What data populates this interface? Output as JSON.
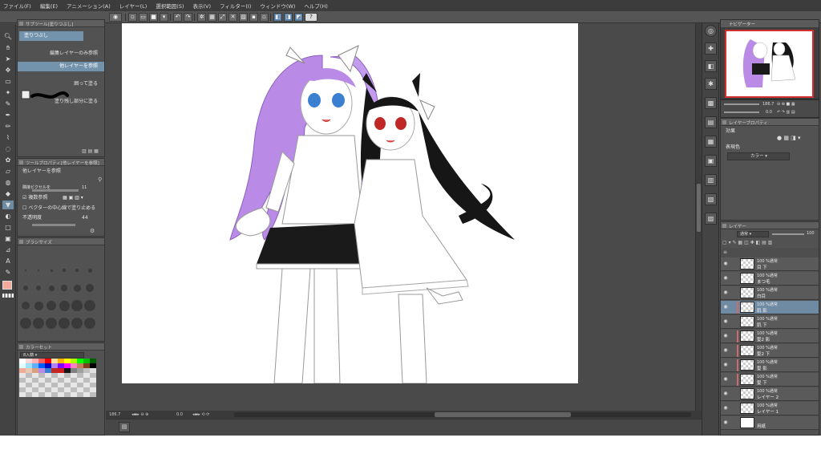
{
  "menu": [
    "ファイル(F)",
    "編集(E)",
    "アニメーション(A)",
    "レイヤー(L)",
    "選択範囲(S)",
    "表示(V)",
    "フィルター(I)",
    "ウィンドウ(W)",
    "ヘルプ(H)"
  ],
  "command_bar": {
    "help_label": "?"
  },
  "subtool": {
    "title": "サブツール[塗りつぶし]",
    "items": [
      {
        "label": "塗りつぶし"
      },
      {
        "label": "編集レイヤーのみ参照"
      },
      {
        "label": "他レイヤーを参照"
      },
      {
        "label": "囲って塗る"
      },
      {
        "label": "塗り残し部分に塗る"
      }
    ]
  },
  "tool_property": {
    "title": "ツールプロパティ[他レイヤーを参照]",
    "header": "他レイヤーを参照",
    "rows": [
      {
        "label": "隣接ピクセルを",
        "value": "11"
      },
      {
        "label": "複数参照"
      },
      {
        "label": "ベクターの中心線で塗り止める"
      },
      {
        "label": "不透明度",
        "value": "44"
      }
    ]
  },
  "brush_size": {
    "title": "ブラシサイズ"
  },
  "color_set": {
    "title": "カラーセット",
    "dropdown": "カラー",
    "label": "8入籍"
  },
  "status": {
    "zoom": "186.7",
    "angle": "0.0"
  },
  "navigator": {
    "title": "ナビゲーター",
    "zoom": "186.7",
    "angle": "0.0"
  },
  "layer_property": {
    "title": "レイヤープロパティ",
    "effect_label": "効果",
    "display_color_label": "表現色",
    "display_color_value": "カラー"
  },
  "layer_panel": {
    "title": "レイヤー",
    "blend_mode": "通常",
    "opacity": "100",
    "layers": [
      {
        "pct": "100 %通常",
        "name": "目 下",
        "selected": false
      },
      {
        "pct": "100 %通常",
        "name": "まつ毛",
        "selected": false
      },
      {
        "pct": "100 %通常",
        "name": "白目",
        "selected": false
      },
      {
        "pct": "100 %通常",
        "name": "肌 影",
        "selected": true
      },
      {
        "pct": "100 %通常",
        "name": "肌 下",
        "selected": false
      },
      {
        "pct": "100 %通常",
        "name": "髪2 影",
        "selected": false
      },
      {
        "pct": "100 %通常",
        "name": "髪2 下",
        "selected": false
      },
      {
        "pct": "100 %通常",
        "name": "髪 影",
        "selected": false
      },
      {
        "pct": "100 %通常",
        "name": "髪 下",
        "selected": false
      },
      {
        "pct": "100 %通常",
        "name": "レイヤー 2",
        "selected": false
      },
      {
        "pct": "100 %通常",
        "name": "レイヤー 1",
        "selected": false
      },
      {
        "pct": "",
        "name": "用紙",
        "selected": false
      }
    ]
  },
  "colors": {
    "fg": "#f3a99a",
    "purple_hair": "#b98be6",
    "black_hair": "#161616",
    "eye_blue": "#3b7fd0",
    "eye_red": "#c02828",
    "ribbon_red": "#cc2020",
    "skirt": "#1a1a1a"
  }
}
